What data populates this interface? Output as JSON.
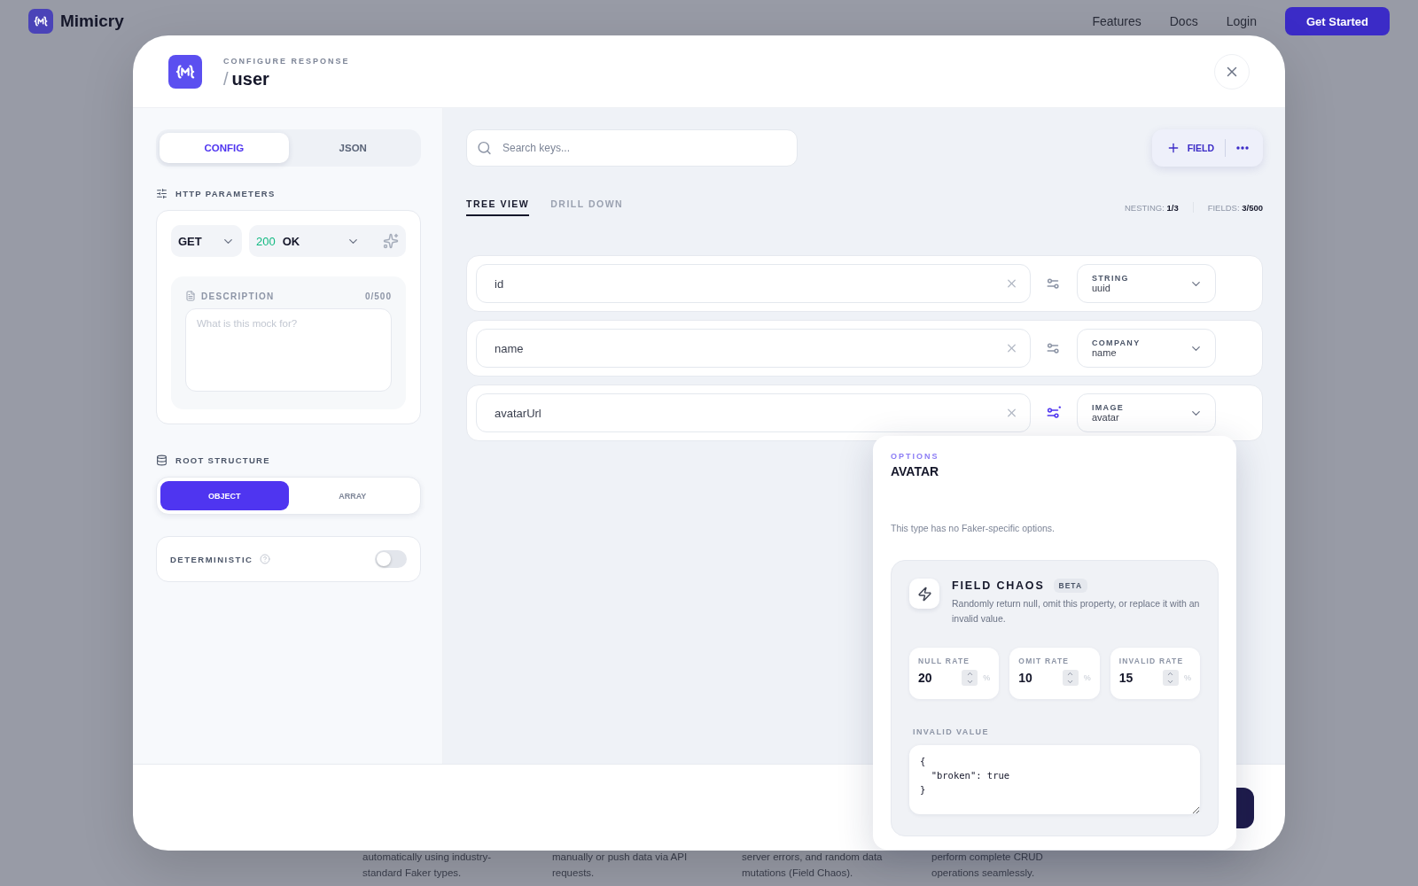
{
  "app": {
    "name": "Mimicry"
  },
  "nav": {
    "links": [
      "Features",
      "Docs",
      "Login"
    ],
    "cta": "Get Started"
  },
  "background_features": [
    {
      "lines": [
        "automatically using industry-",
        "standard Faker types."
      ]
    },
    {
      "lines": [
        "manually or push data via API",
        "requests."
      ]
    },
    {
      "lines": [
        "server errors, and random data",
        "mutations (Field Chaos)."
      ]
    },
    {
      "lines": [
        "perform complete CRUD",
        "operations seamlessly."
      ]
    }
  ],
  "modal": {
    "eyebrow": "CONFIGURE RESPONSE",
    "slash": "/",
    "title": "user"
  },
  "sidebar": {
    "tabs": [
      {
        "label": "CONFIG",
        "selected": true
      },
      {
        "label": "JSON",
        "selected": false
      }
    ],
    "http_section": "HTTP PARAMETERS",
    "method": "GET",
    "status_code": "200",
    "status_text": "OK",
    "description": {
      "label": "DESCRIPTION",
      "counter": "0/500",
      "placeholder": "What is this mock for?"
    },
    "root_section": "ROOT STRUCTURE",
    "root_options": [
      {
        "label": "OBJECT",
        "selected": true
      },
      {
        "label": "ARRAY",
        "selected": false
      }
    ],
    "deterministic": {
      "label": "DETERMINISTIC",
      "on": false
    }
  },
  "editor": {
    "search": {
      "placeholder": "Search keys..."
    },
    "add_field": "FIELD",
    "views": [
      {
        "label": "TREE VIEW",
        "selected": true
      },
      {
        "label": "DRILL DOWN",
        "selected": false
      }
    ],
    "stats": [
      {
        "label": "NESTING:",
        "value": "1/3"
      },
      {
        "label": "FIELDS:",
        "value": "3/500"
      }
    ],
    "fields": [
      {
        "key": "id",
        "type": "STRING",
        "subtype": "uuid",
        "options_open": false
      },
      {
        "key": "name",
        "type": "COMPANY",
        "subtype": "name",
        "options_open": false
      },
      {
        "key": "avatarUrl",
        "type": "IMAGE",
        "subtype": "avatar",
        "options_open": true
      }
    ]
  },
  "options_popover": {
    "eyebrow": "OPTIONS",
    "title": "AVATAR",
    "note": "This type has no Faker-specific options.",
    "chaos": {
      "title": "FIELD CHAOS",
      "badge": "BETA",
      "description": "Randomly return null, omit this property, or replace it with an invalid value.",
      "rates": [
        {
          "label": "NULL RATE",
          "value": "20",
          "unit": "%"
        },
        {
          "label": "OMIT RATE",
          "value": "10",
          "unit": "%"
        },
        {
          "label": "INVALID RATE",
          "value": "15",
          "unit": "%"
        }
      ],
      "invalid_label": "INVALID VALUE",
      "invalid_value": "{\n  \"broken\": true\n}"
    }
  }
}
